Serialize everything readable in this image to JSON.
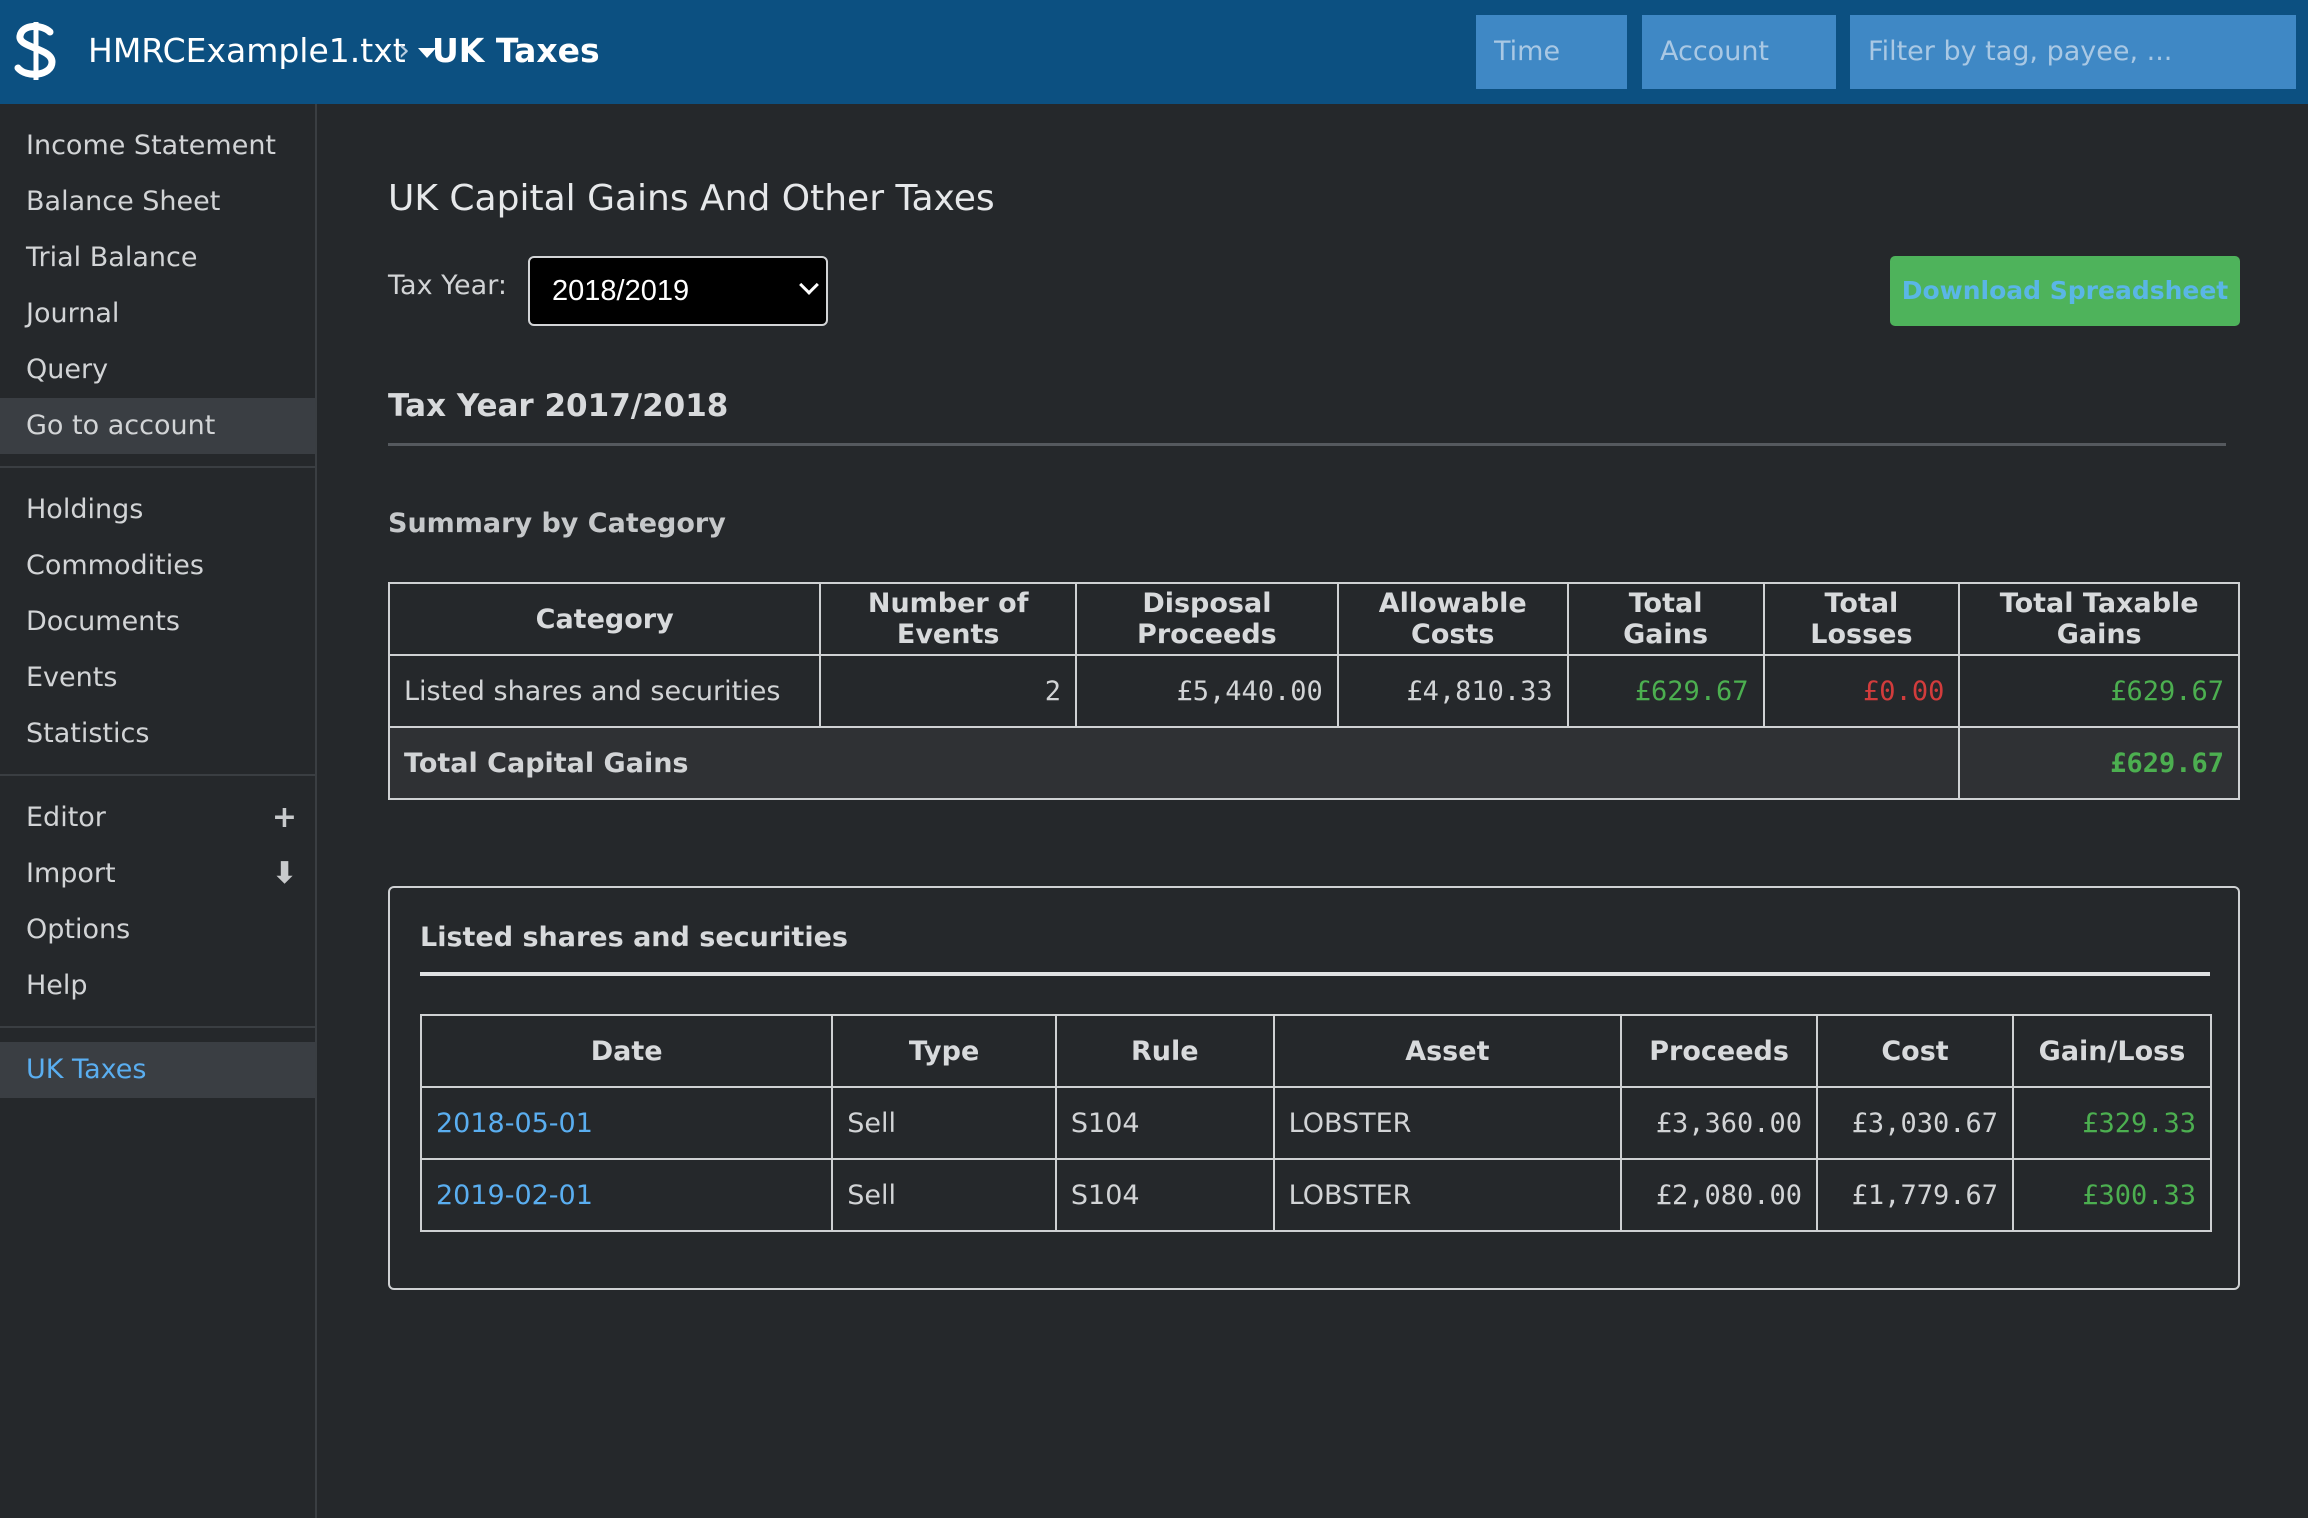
{
  "header": {
    "ledger_name": "HMRCExample1.txt",
    "breadcrumb_sep": "›",
    "current_page": "UK Taxes",
    "time_placeholder": "Time",
    "account_placeholder": "Account",
    "filter_placeholder": "Filter by tag, payee, ..."
  },
  "sidebar": {
    "group1": [
      "Income Statement",
      "Balance Sheet",
      "Trial Balance",
      "Journal",
      "Query",
      "Go to account"
    ],
    "group2": [
      "Holdings",
      "Commodities",
      "Documents",
      "Events",
      "Statistics"
    ],
    "group3": [
      "Editor",
      "Import",
      "Options",
      "Help"
    ],
    "group4": [
      "UK Taxes"
    ],
    "editor_icon": "+",
    "import_icon": "⬇"
  },
  "main": {
    "title": "UK Capital Gains And Other Taxes",
    "tax_year_label": "Tax Year:",
    "tax_year_value": "2018/2019",
    "download_label": "Download Spreadsheet",
    "section_title": "Tax Year 2017/2018",
    "summary_title": "Summary by Category",
    "summary_headers": [
      "Category",
      "Number of Events",
      "Disposal Proceeds",
      "Allowable Costs",
      "Total Gains",
      "Total Losses",
      "Total Taxable Gains"
    ],
    "summary_row": [
      "Listed shares and securities",
      "2",
      "£5,440.00",
      "£4,810.33",
      "£629.67",
      "£0.00",
      "£629.67"
    ],
    "total_label": "Total Capital Gains",
    "total_value": "£629.67",
    "detail_title": "Listed shares and securities",
    "detail_headers": [
      "Date",
      "Type",
      "Rule",
      "Asset",
      "Proceeds",
      "Cost",
      "Gain/Loss"
    ],
    "detail_rows": [
      [
        "2018-05-01",
        "Sell",
        "S104",
        "LOBSTER",
        "£3,360.00",
        "£3,030.67",
        "£329.33"
      ],
      [
        "2019-02-01",
        "Sell",
        "S104",
        "LOBSTER",
        "£2,080.00",
        "£1,779.67",
        "£300.33"
      ]
    ]
  },
  "colors": {
    "header_bg": "#0c5081",
    "gain_green": "#4caf50",
    "loss_red": "#d23c3c",
    "link_blue": "#5aaef0",
    "download_bg": "#4eb35b"
  }
}
